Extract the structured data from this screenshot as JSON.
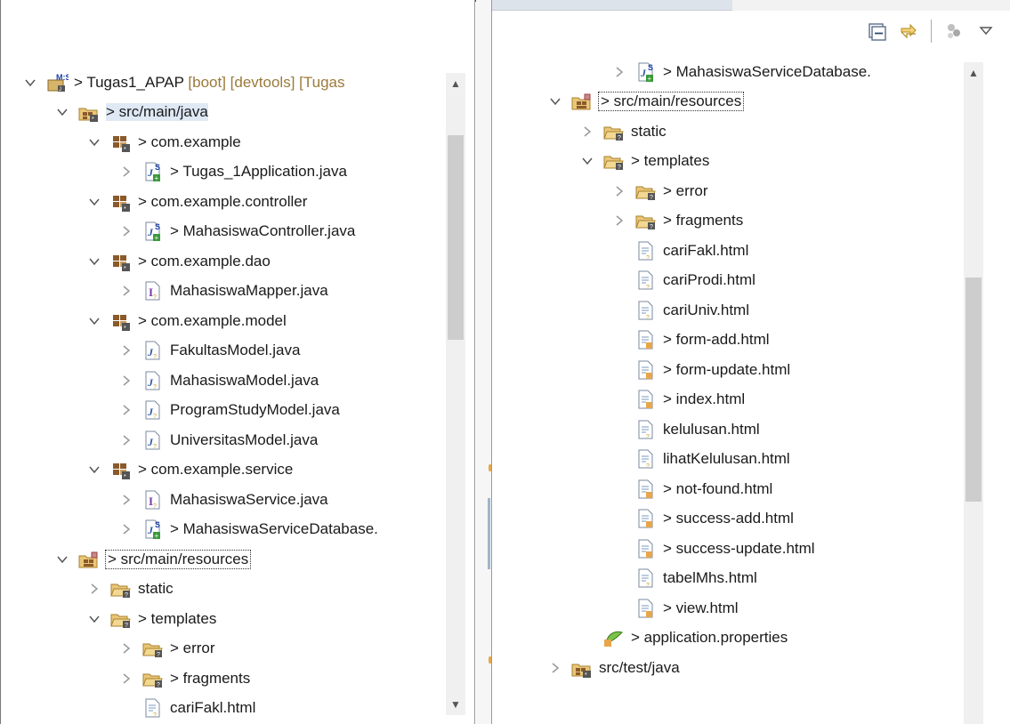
{
  "left": {
    "rows": [
      {
        "label": "> Tugas1_APAP",
        "decoration": " [boot] [devtools] [Tugas",
        "icon": "project",
        "expanded": true,
        "level": 0
      },
      {
        "label": "> src/main/java",
        "icon": "source-folder",
        "expanded": true,
        "level": 1,
        "selected": true
      },
      {
        "label": "> com.example",
        "icon": "package",
        "expanded": true,
        "level": 2
      },
      {
        "label": "> Tugas_1Application.java",
        "icon": "java-file-spring",
        "expanded": false,
        "level": 3
      },
      {
        "label": "> com.example.controller",
        "icon": "package",
        "expanded": true,
        "level": 2
      },
      {
        "label": "> MahasiswaController.java",
        "icon": "java-file-spring",
        "expanded": false,
        "level": 3
      },
      {
        "label": "> com.example.dao",
        "icon": "package",
        "expanded": true,
        "level": 2
      },
      {
        "label": "MahasiswaMapper.java",
        "icon": "java-interface",
        "expanded": false,
        "level": 3
      },
      {
        "label": "> com.example.model",
        "icon": "package",
        "expanded": true,
        "level": 2
      },
      {
        "label": "FakultasModel.java",
        "icon": "java-file",
        "expanded": false,
        "level": 3
      },
      {
        "label": "MahasiswaModel.java",
        "icon": "java-file",
        "expanded": false,
        "level": 3
      },
      {
        "label": "ProgramStudyModel.java",
        "icon": "java-file",
        "expanded": false,
        "level": 3
      },
      {
        "label": "UniversitasModel.java",
        "icon": "java-file",
        "expanded": false,
        "level": 3
      },
      {
        "label": "> com.example.service",
        "icon": "package",
        "expanded": true,
        "level": 2
      },
      {
        "label": "MahasiswaService.java",
        "icon": "java-interface",
        "expanded": false,
        "level": 3
      },
      {
        "label": "> MahasiswaServiceDatabase.",
        "icon": "java-file-spring",
        "expanded": false,
        "level": 3
      },
      {
        "label": "> src/main/resources",
        "icon": "resource-folder",
        "expanded": true,
        "level": 1,
        "boxed": true
      },
      {
        "label": "static",
        "icon": "folder",
        "expanded": false,
        "level": 2
      },
      {
        "label": "> templates",
        "icon": "folder",
        "expanded": true,
        "level": 2
      },
      {
        "label": "> error",
        "icon": "folder",
        "expanded": false,
        "level": 3
      },
      {
        "label": "> fragments",
        "icon": "folder",
        "expanded": false,
        "level": 3
      },
      {
        "label": "cariFakl.html",
        "icon": "html-file",
        "expanded": null,
        "level": 3
      }
    ]
  },
  "right": {
    "toolbar": {
      "collapse_all": "collapse-all-icon",
      "link_editor": "link-with-editor-icon",
      "filters": "filters-icon",
      "view_menu": "view-menu-icon"
    },
    "rows": [
      {
        "label": "> MahasiswaServiceDatabase.",
        "icon": "java-file-spring",
        "expanded": false,
        "level": 3
      },
      {
        "label": "> src/main/resources",
        "icon": "resource-folder",
        "expanded": true,
        "level": 1,
        "boxed": true
      },
      {
        "label": "static",
        "icon": "folder",
        "expanded": false,
        "level": 2
      },
      {
        "label": "> templates",
        "icon": "folder",
        "expanded": true,
        "level": 2
      },
      {
        "label": "> error",
        "icon": "folder",
        "expanded": false,
        "level": 3
      },
      {
        "label": "> fragments",
        "icon": "folder",
        "expanded": false,
        "level": 3
      },
      {
        "label": "cariFakl.html",
        "icon": "html-file",
        "expanded": null,
        "level": 3
      },
      {
        "label": "cariProdi.html",
        "icon": "html-file",
        "expanded": null,
        "level": 3
      },
      {
        "label": "cariUniv.html",
        "icon": "html-file",
        "expanded": null,
        "level": 3
      },
      {
        "label": "> form-add.html",
        "icon": "html-file-modified",
        "expanded": null,
        "level": 3
      },
      {
        "label": "> form-update.html",
        "icon": "html-file-modified",
        "expanded": null,
        "level": 3
      },
      {
        "label": "> index.html",
        "icon": "html-file-modified",
        "expanded": null,
        "level": 3
      },
      {
        "label": "kelulusan.html",
        "icon": "html-file",
        "expanded": null,
        "level": 3
      },
      {
        "label": "lihatKelulusan.html",
        "icon": "html-file",
        "expanded": null,
        "level": 3
      },
      {
        "label": "> not-found.html",
        "icon": "html-file-modified",
        "expanded": null,
        "level": 3
      },
      {
        "label": "> success-add.html",
        "icon": "html-file-modified",
        "expanded": null,
        "level": 3
      },
      {
        "label": "> success-update.html",
        "icon": "html-file-modified",
        "expanded": null,
        "level": 3
      },
      {
        "label": "tabelMhs.html",
        "icon": "html-file",
        "expanded": null,
        "level": 3
      },
      {
        "label": "> view.html",
        "icon": "html-file-modified",
        "expanded": null,
        "level": 3
      },
      {
        "label": "> application.properties",
        "icon": "properties-file",
        "expanded": null,
        "level": 2
      },
      {
        "label": "src/test/java",
        "icon": "source-folder",
        "expanded": false,
        "level": 1
      }
    ]
  },
  "colors": {
    "decoration": "#9b7a3a",
    "selection": "#dfe9f5",
    "scrollbar_thumb": "#cdcdcd"
  }
}
